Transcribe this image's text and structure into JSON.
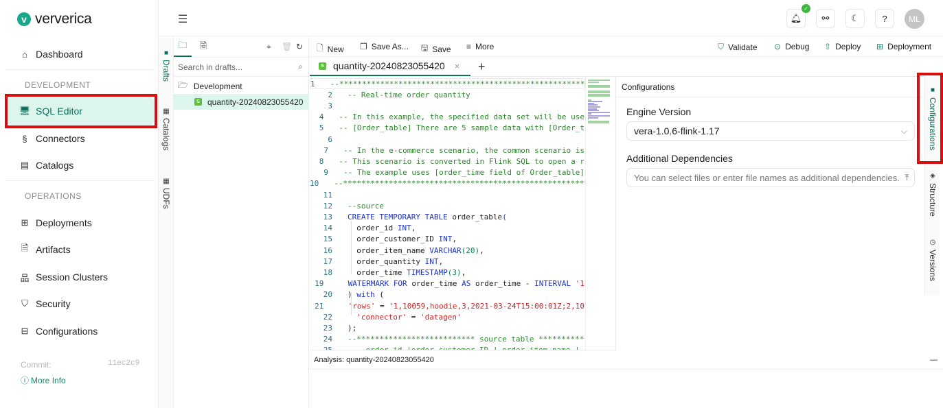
{
  "brand": {
    "name": "ververica",
    "accent": "#18a88c"
  },
  "sidebar": {
    "items": [
      {
        "label": "Dashboard",
        "icon": "home-icon"
      },
      {
        "section": "DEVELOPMENT"
      },
      {
        "label": "SQL Editor",
        "icon": "sql-monitor-icon",
        "active": true
      },
      {
        "label": "Connectors",
        "icon": "connectors-icon"
      },
      {
        "label": "Catalogs",
        "icon": "catalogs-icon"
      },
      {
        "section": "OPERATIONS"
      },
      {
        "label": "Deployments",
        "icon": "deployments-icon"
      },
      {
        "label": "Artifacts",
        "icon": "artifacts-icon"
      },
      {
        "label": "Session Clusters",
        "icon": "session-clusters-icon"
      },
      {
        "label": "Security",
        "icon": "shield-icon"
      },
      {
        "label": "Configurations",
        "icon": "configurations-icon"
      }
    ],
    "commit_label": "Commit:",
    "commit_hash": "11ec2c9",
    "more_info": "More Info"
  },
  "topbar": {
    "avatar_initials": "ML",
    "notification_badge": "✓"
  },
  "left_vtabs": [
    {
      "label": "Drafts",
      "active": true
    },
    {
      "label": "Catalogs"
    },
    {
      "label": "UDFs"
    }
  ],
  "drafts": {
    "search_placeholder": "Search in drafts...",
    "folder": "Development",
    "files": [
      {
        "name": "quantity-20240823055420",
        "badge": "S",
        "selected": true
      }
    ]
  },
  "editor_toolbar": {
    "new": "New",
    "save_as": "Save As...",
    "save": "Save",
    "more": "More",
    "validate": "Validate",
    "debug": "Debug",
    "deploy": "Deploy",
    "deployment": "Deployment"
  },
  "file_tab": {
    "badge": "S",
    "name": "quantity-20240823055420",
    "close": "×",
    "add": "+"
  },
  "code_lines": [
    [
      [
        "cm",
        "--********************************************************"
      ]
    ],
    [
      [
        "cm",
        "-- Real-time order quantity"
      ]
    ],
    [],
    [
      [
        "cm",
        "-- In this example, the specified data set will be use"
      ]
    ],
    [
      [
        "cm",
        "-- [Order_table] There are 5 sample data with [Order_t"
      ]
    ],
    [],
    [
      [
        "cm",
        "-- In the e-commerce scenario, the common scenario is"
      ]
    ],
    [
      [
        "cm",
        "-- This scenario is converted in Flink SQL to open a r"
      ]
    ],
    [
      [
        "cm",
        "-- The example uses [order_time field of Order_table]"
      ]
    ],
    [
      [
        "cm",
        "--********************************************************"
      ]
    ],
    [],
    [
      [
        "cm",
        "--source"
      ]
    ],
    [
      [
        "kw",
        "CREATE TEMPORARY TABLE "
      ],
      [
        "tx",
        "order_table"
      ],
      [
        "kw",
        "("
      ]
    ],
    [
      [
        "tx",
        "  order_id "
      ],
      [
        "kw",
        "INT"
      ],
      [
        "tx",
        ","
      ]
    ],
    [
      [
        "tx",
        "  order_customer_ID "
      ],
      [
        "kw",
        "INT"
      ],
      [
        "tx",
        ","
      ]
    ],
    [
      [
        "tx",
        "  order_item_name "
      ],
      [
        "kw",
        "VARCHAR"
      ],
      [
        "num",
        "(20)"
      ],
      [
        "tx",
        ","
      ]
    ],
    [
      [
        "tx",
        "  order_quantity "
      ],
      [
        "kw",
        "INT"
      ],
      [
        "tx",
        ","
      ]
    ],
    [
      [
        "tx",
        "  order_time "
      ],
      [
        "kw",
        "TIMESTAMP"
      ],
      [
        "num",
        "(3)"
      ],
      [
        "tx",
        ","
      ]
    ],
    [
      [
        "kw",
        "  WATERMARK FOR "
      ],
      [
        "tx",
        "order_time "
      ],
      [
        "kw",
        "AS "
      ],
      [
        "tx",
        "order_time - "
      ],
      [
        "kw",
        "INTERVAL "
      ],
      [
        "str",
        "'1"
      ]
    ],
    [
      [
        "tx",
        ") "
      ],
      [
        "kw",
        "with"
      ],
      [
        "tx",
        " ("
      ]
    ],
    [
      [
        "str",
        "  'rows'"
      ],
      [
        "tx",
        " = "
      ],
      [
        "str",
        "'1,10059,hoodie,3,2021-03-24T15:00:01Z;2,10"
      ]
    ],
    [
      [
        "str",
        "  'connector'"
      ],
      [
        "tx",
        " = "
      ],
      [
        "str",
        "'datagen'"
      ]
    ],
    [
      [
        "tx",
        ");"
      ]
    ],
    [
      [
        "cm",
        "--************************** source table **********"
      ]
    ],
    [
      [
        "cm",
        "--  order_id |order_customer_ID | order_item_name |"
      ]
    ]
  ],
  "config_panel": {
    "title": "Configurations",
    "engine_version_label": "Engine Version",
    "engine_version_value": "vera-1.0.6-flink-1.17",
    "deps_label": "Additional Dependencies",
    "deps_placeholder": "You can select files or enter file names as additional dependencies."
  },
  "right_vtabs": [
    {
      "label": "Configurations",
      "active": true
    },
    {
      "label": "Structure"
    },
    {
      "label": "Versions"
    }
  ],
  "analysis": {
    "title": "Analysis: quantity-20240823055420",
    "minimize": "—"
  }
}
